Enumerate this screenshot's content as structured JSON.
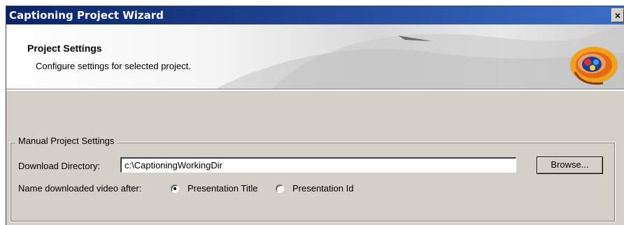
{
  "window": {
    "title": "Captioning Project Wizard",
    "close_glyph": "×"
  },
  "header": {
    "title": "Project Settings",
    "subtitle": "Configure settings for selected project.",
    "logo_icon": "captioning-logo-icon"
  },
  "manual_settings": {
    "legend": "Manual Project Settings",
    "download_directory_label": "Download Directory:",
    "download_directory_value": "c:\\CaptioningWorkingDir",
    "browse_label": "Browse...",
    "name_after_label": "Name downloaded video  after:",
    "options": [
      {
        "label": "Presentation Title",
        "selected": true
      },
      {
        "label": "Presentation Id",
        "selected": false
      }
    ]
  },
  "colors": {
    "titlebar": "#0a246a",
    "dialog_bg": "#d4d0c8"
  }
}
